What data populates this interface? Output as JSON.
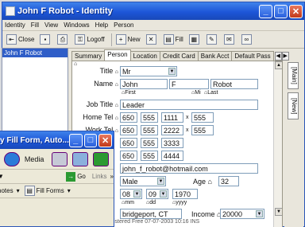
{
  "window": {
    "title": "John F Robot - Identity"
  },
  "menu": [
    "Identity",
    "Fill",
    "View",
    "Windows",
    "Help",
    "Person"
  ],
  "toolbar": {
    "close": "Close",
    "logoff": "Logoff",
    "new": "New",
    "fill": "Fill"
  },
  "left": {
    "selected": "John F Robot"
  },
  "tabs": [
    "Summary",
    "Person",
    "Location",
    "Credit Card",
    "Bank Acct",
    "Default Pass"
  ],
  "side_tabs": [
    "[Main]",
    "[New]"
  ],
  "form": {
    "title_label": "Title",
    "title": "Mr",
    "name_label": "Name",
    "first": "John",
    "mi": "F",
    "last": "Robot",
    "first_cap": "First",
    "mi_cap": "Mi",
    "last_cap": "Last",
    "job_label": "Job Title",
    "job": "Leader",
    "home_label": "Home Tel",
    "home": [
      "650",
      "555",
      "1111"
    ],
    "home_ext": "555",
    "work_label": "Work Tel",
    "work": [
      "650",
      "555",
      "2222"
    ],
    "work_ext": "555",
    "tel3": [
      "650",
      "555",
      "3333"
    ],
    "tel4": [
      "650",
      "555",
      "4444"
    ],
    "email": "john_f_robot@hotmail.com",
    "sex": "Male",
    "age_label": "Age",
    "age": "32",
    "mm": "08",
    "dd": "09",
    "yyyy": "1970",
    "mm_cap": "mm",
    "dd_cap": "dd",
    "yyyy_cap": "yyyy",
    "city": "bridgeport, CT",
    "income_label": "Income",
    "income": "20000",
    "x1": "x",
    "x2": "x"
  },
  "status": "istered    Free    07-07-2003 10:16      INS",
  "ie": {
    "title": "y Fill Form, Auto...",
    "media": "Media",
    "go": "Go",
    "links": "Links",
    "notes": "notes",
    "fillforms": "Fill Forms"
  }
}
